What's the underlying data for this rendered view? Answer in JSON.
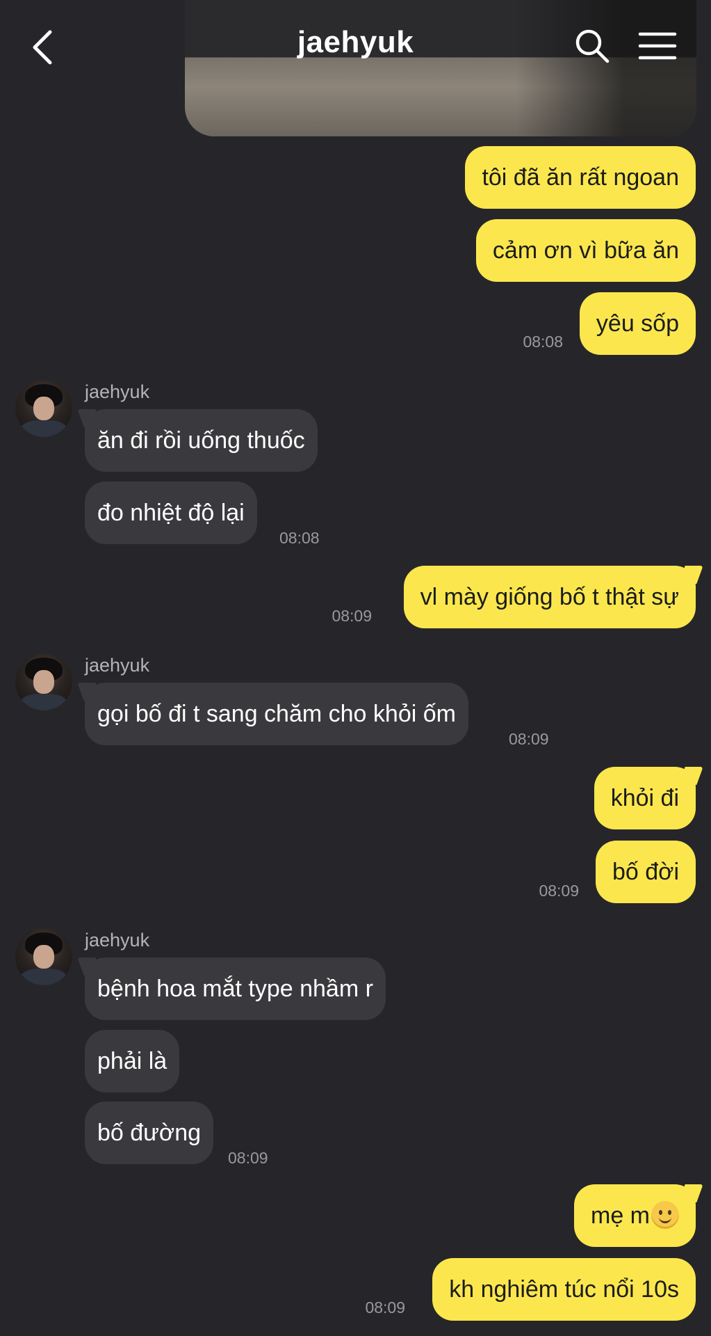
{
  "header": {
    "title": "jaehyuk"
  },
  "messages": [
    {
      "text": "tôi đã ăn rất ngoan"
    },
    {
      "text": "cảm ơn vì bữa ăn"
    },
    {
      "text": "yêu sốp",
      "time": "08:08"
    },
    {
      "sender": "jaehyuk",
      "text": "ăn đi rồi uống thuốc"
    },
    {
      "text": "đo nhiệt độ lại",
      "time": "08:08"
    },
    {
      "text": "vl mày giống bố t thật sự",
      "time": "08:09"
    },
    {
      "sender": "jaehyuk",
      "text": "gọi bố đi t sang chăm cho khỏi ốm",
      "time": "08:09"
    },
    {
      "text": "khỏi đi"
    },
    {
      "text": "bố đời",
      "time": "08:09"
    },
    {
      "sender": "jaehyuk",
      "text": "bệnh hoa mắt type nhầm r"
    },
    {
      "text": "phải là"
    },
    {
      "text": "bố đường",
      "time": "08:09"
    },
    {
      "text": "mẹ m",
      "emoji": "slightly-smiling-face"
    },
    {
      "text": "kh nghiêm túc nổi 10s",
      "time": "08:09"
    }
  ],
  "icons": {
    "back": "chevron-left-icon",
    "search": "search-icon",
    "menu": "hamburger-menu-icon"
  },
  "colors": {
    "background": "#26262a",
    "outgoing_bubble": "#fbe74d",
    "incoming_bubble": "#3a3a3e"
  }
}
